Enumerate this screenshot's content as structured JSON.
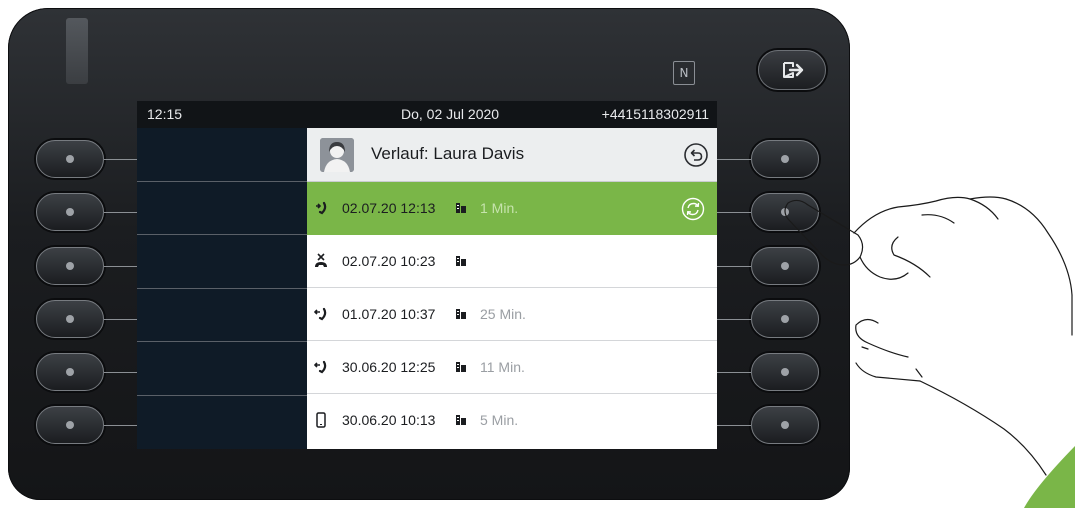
{
  "status_bar": {
    "time": "12:15",
    "date": "Do, 02 Jul 2020",
    "number": "+4415118302911"
  },
  "header": {
    "title": "Verlauf: Laura Davis"
  },
  "calls": [
    {
      "icon": "outgoing-call-icon",
      "datetime": "02.07.20 12:13",
      "duration": "1 Min.",
      "selected": true
    },
    {
      "icon": "missed-call-icon",
      "datetime": "02.07.20 10:23",
      "duration": "",
      "selected": false
    },
    {
      "icon": "incoming-call-icon",
      "datetime": "01.07.20 10:37",
      "duration": "25 Min.",
      "selected": false
    },
    {
      "icon": "incoming-call-icon",
      "datetime": "30.06.20 12:25",
      "duration": "11 Min.",
      "selected": false
    },
    {
      "icon": "mobile-phone-icon",
      "datetime": "30.06.20 10:13",
      "duration": "5 Min.",
      "selected": false
    }
  ],
  "colors": {
    "selected_row": "#7ab648",
    "screen_left": "#0f1b27",
    "device_body": "#1b1d20"
  },
  "icons": {
    "nfc": "nfc-icon",
    "exit": "exit-icon",
    "back": "back-icon",
    "sync": "sync-icon",
    "building": "building-icon",
    "avatar": "avatar"
  },
  "nfc_label": "N"
}
